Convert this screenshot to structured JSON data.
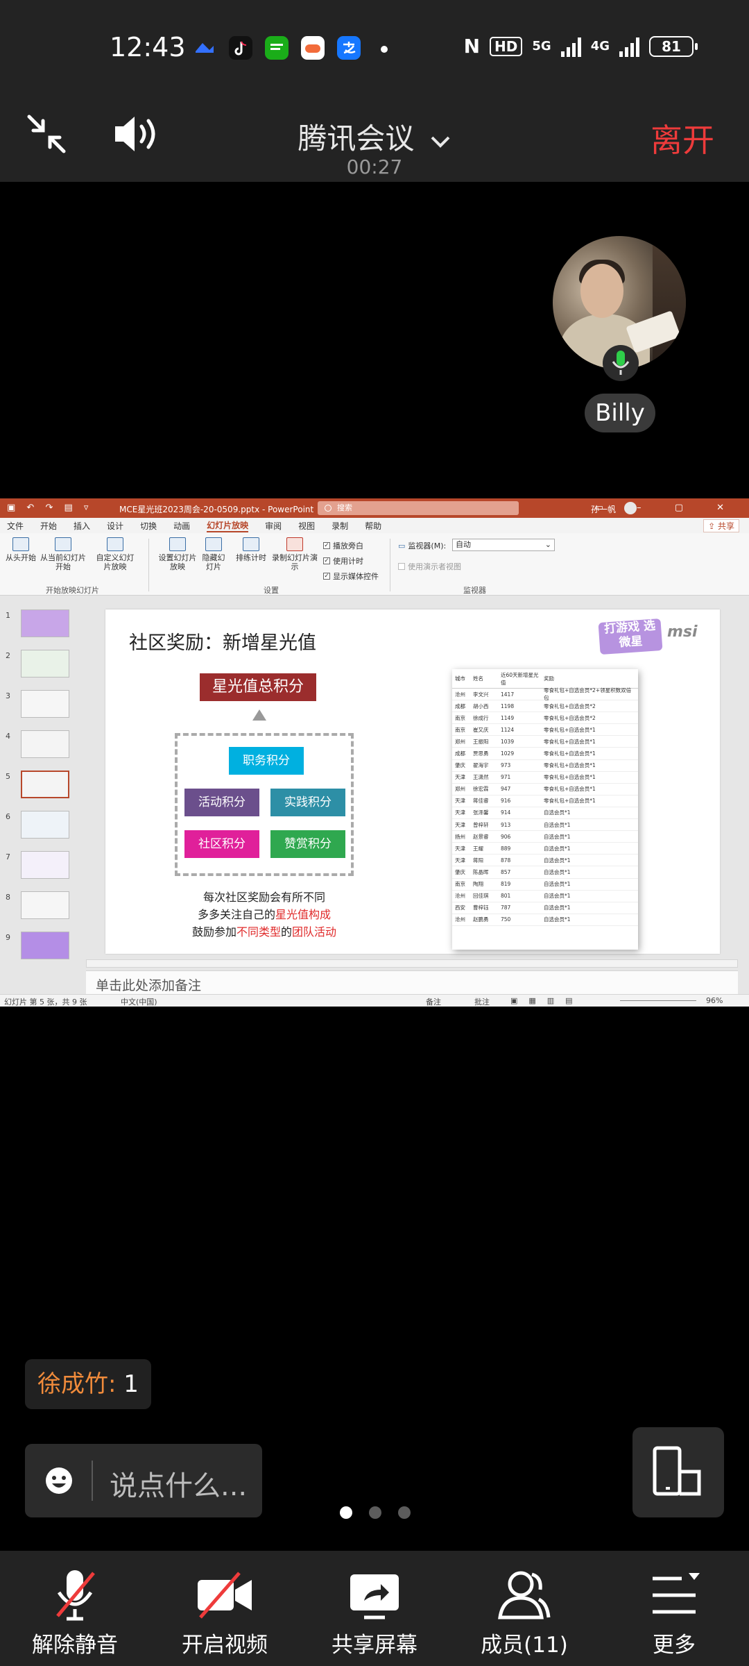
{
  "status_bar": {
    "time": "12:43",
    "app_icons": [
      "feishu-icon",
      "tiktok-icon",
      "wechat-pay-icon",
      "game-icon",
      "alipay-icon"
    ],
    "hd_label": "HD",
    "network_5g": "5G",
    "network_4g": "4G",
    "battery": "81"
  },
  "meeting": {
    "title": "腾讯会议",
    "timer": "00:27",
    "leave_label": "离开"
  },
  "participant": {
    "name": "Billy"
  },
  "ppt": {
    "title_bar": {
      "filename": "MCE星光班2023周会-20-0509.pptx - PowerPoint",
      "search_placeholder": "搜索",
      "user": "孙一帆"
    },
    "tabs": [
      "文件",
      "开始",
      "插入",
      "设计",
      "切换",
      "动画",
      "幻灯片放映",
      "审阅",
      "视图",
      "录制",
      "帮助"
    ],
    "active_tab": "幻灯片放映",
    "share_label": "共享",
    "ribbon": {
      "from_start": "从头开始",
      "from_current": "从当前幻灯片开始",
      "custom": "自定义幻灯片放映",
      "group_start": "开始放映幻灯片",
      "setup": "设置幻灯片放映",
      "hide": "隐藏幻灯片",
      "rehearse": "排练计时",
      "record": "录制幻灯片演示",
      "play_narration": "播放旁白",
      "use_timings": "使用计时",
      "show_media": "显示媒体控件",
      "group_setup": "设置",
      "monitor_label": "监视器(M):",
      "monitor_value": "自动",
      "presenter_view": "使用演示者视图",
      "group_monitor": "监视器"
    },
    "slide_count": 9,
    "selected_slide": 5,
    "slide": {
      "heading": "社区奖励：新增星光值",
      "logo_badge": "打游戏 选微星",
      "logo_msi": "msi",
      "total_label": "星光值总积分",
      "boxes": [
        {
          "label": "职务积分",
          "color": "#00b0e0"
        },
        {
          "label": "活动积分",
          "color": "#6b4f8c"
        },
        {
          "label": "实践积分",
          "color": "#2d8fa6"
        },
        {
          "label": "社区积分",
          "color": "#e0209a"
        },
        {
          "label": "赞赏积分",
          "color": "#2fa84f"
        }
      ],
      "caption": {
        "line1": "每次社区奖励会有所不同",
        "line2_a": "多多关注自己的",
        "line2_b": "星光值构成",
        "line3_a": "鼓励参加",
        "line3_b": "不同类型",
        "line3_c": "的",
        "line3_d": "团队活动"
      },
      "table": {
        "headers": [
          "城市",
          "姓名",
          "近60天新增星光值",
          "奖励"
        ],
        "rows": [
          [
            "沧州",
            "李文兴",
            "1417",
            "零食礼包+自选会员*2+领星积数双倍包"
          ],
          [
            "成都",
            "胡小西",
            "1198",
            "零食礼包+自选会员*2"
          ],
          [
            "南京",
            "徐成行",
            "1149",
            "零食礼包+自选会员*2"
          ],
          [
            "南京",
            "崔又庆",
            "1124",
            "零食礼包+自选会员*1"
          ],
          [
            "郑州",
            "王振阳",
            "1039",
            "零食礼包+自选会员*1"
          ],
          [
            "成都",
            "贾思勇",
            "1029",
            "零食礼包+自选会员*1"
          ],
          [
            "肇庆",
            "翟海宇",
            "973",
            "零食礼包+自选会员*1"
          ],
          [
            "天津",
            "王潇然",
            "971",
            "零食礼包+自选会员*1"
          ],
          [
            "郑州",
            "徐宏霖",
            "947",
            "零食礼包+自选会员*1"
          ],
          [
            "天津",
            "蒋佳睿",
            "916",
            "零食礼包+自选会员*1"
          ],
          [
            "天津",
            "张泽馨",
            "914",
            "自选会员*1"
          ],
          [
            "天津",
            "曾梓轩",
            "913",
            "自选会员*1"
          ],
          [
            "扬州",
            "赵景睿",
            "906",
            "自选会员*1"
          ],
          [
            "天津",
            "王耀",
            "889",
            "自选会员*1"
          ],
          [
            "天津",
            "蒋阳",
            "878",
            "自选会员*1"
          ],
          [
            "肇庆",
            "陈晶晖",
            "857",
            "自选会员*1"
          ],
          [
            "南京",
            "陶翔",
            "819",
            "自选会员*1"
          ],
          [
            "沧州",
            "回佳琪",
            "801",
            "自选会员*1"
          ],
          [
            "西安",
            "曹梓钰",
            "787",
            "自选会员*1"
          ],
          [
            "沧州",
            "赵鹏勇",
            "750",
            "自选会员*1"
          ]
        ]
      }
    },
    "notes_placeholder": "单击此处添加备注",
    "status": {
      "slide_info": "幻灯片 第 5 张，共 9 张",
      "language": "中文(中国)",
      "notes": "备注",
      "comments": "批注",
      "zoom": "96%"
    }
  },
  "danmaku": {
    "who": "徐成竹",
    "sep": ":",
    "text": "1"
  },
  "chat": {
    "placeholder": "说点什么..."
  },
  "pager": {
    "count": 3,
    "active": 0
  },
  "toolbar": {
    "unmute": "解除静音",
    "video": "开启视频",
    "share": "共享屏幕",
    "members": "成员(11)",
    "more": "更多"
  }
}
